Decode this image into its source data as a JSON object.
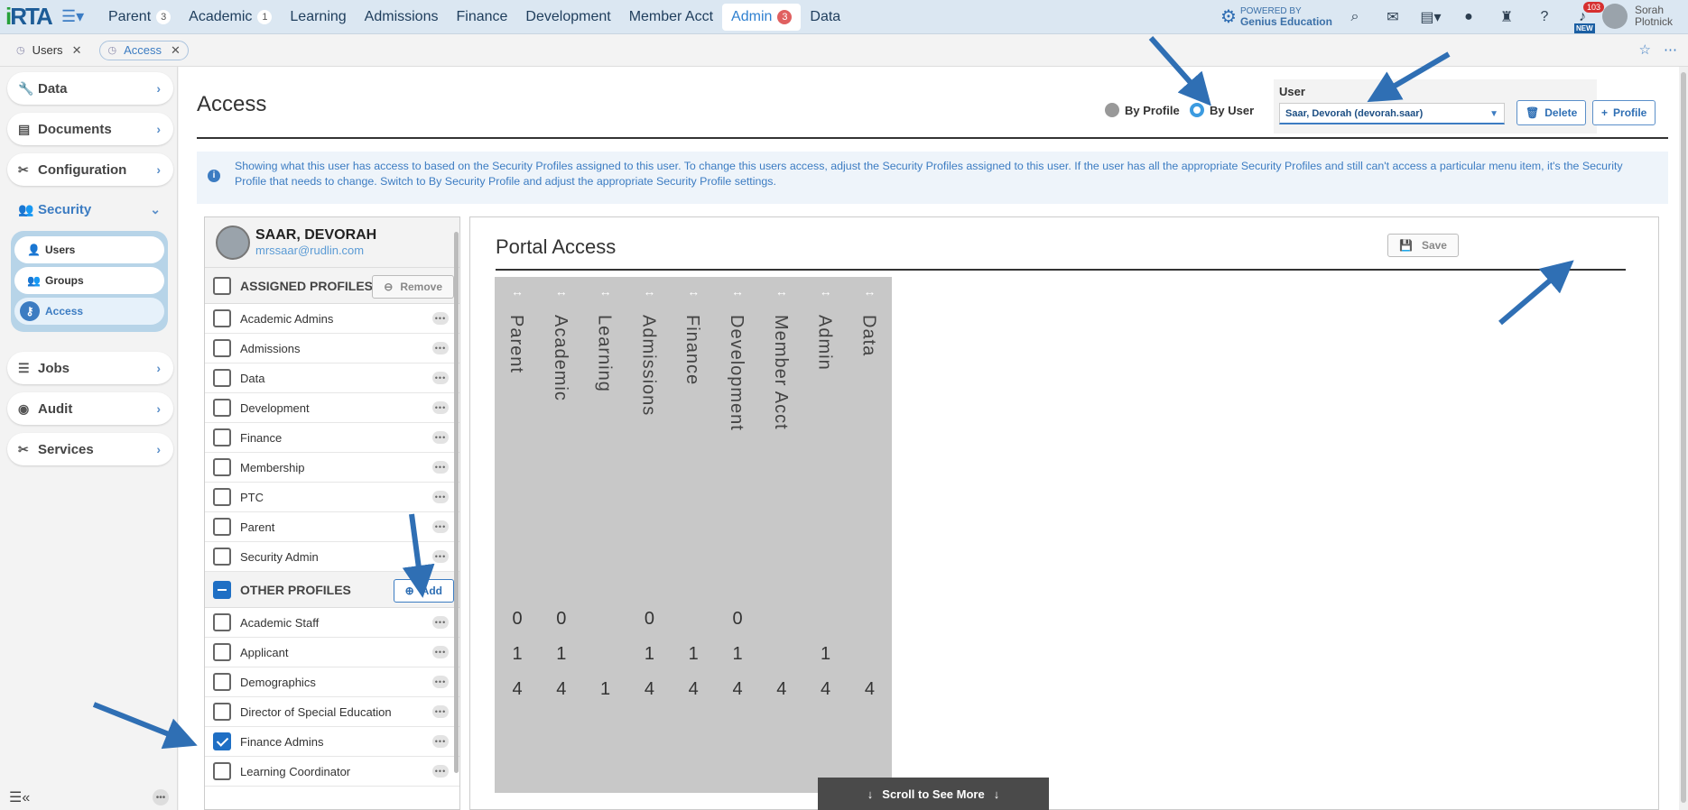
{
  "app": {
    "logo": "RTA",
    "logo_i": "i"
  },
  "nav": {
    "tabs": [
      {
        "label": "Parent",
        "badge": "3"
      },
      {
        "label": "Academic",
        "badge": "1"
      },
      {
        "label": "Learning"
      },
      {
        "label": "Admissions"
      },
      {
        "label": "Finance"
      },
      {
        "label": "Development"
      },
      {
        "label": "Member Acct"
      },
      {
        "label": "Admin",
        "badge": "3",
        "active": true
      },
      {
        "label": "Data"
      }
    ],
    "powered_by": "POWERED BY",
    "powered_brand": "Genius Education",
    "notifications_count": "103",
    "new_badge": "NEW",
    "user_first": "Sorah",
    "user_last": "Plotnick"
  },
  "tabbar": {
    "tabs": [
      {
        "label": "Users"
      },
      {
        "label": "Access",
        "active": true
      }
    ]
  },
  "sidebar": {
    "items": [
      {
        "label": "Data",
        "icon": "wrench-icon"
      },
      {
        "label": "Documents",
        "icon": "document-icon"
      },
      {
        "label": "Configuration",
        "icon": "tools-icon"
      },
      {
        "label": "Security",
        "icon": "users-lock-icon",
        "open": true
      },
      {
        "label": "Jobs",
        "icon": "list-icon"
      },
      {
        "label": "Audit",
        "icon": "eye-icon"
      },
      {
        "label": "Services",
        "icon": "tools-icon"
      }
    ],
    "sub": [
      {
        "label": "Users"
      },
      {
        "label": "Groups"
      },
      {
        "label": "Access",
        "active": true
      }
    ]
  },
  "page": {
    "title": "Access",
    "by_profile": "By Profile",
    "by_user": "By User",
    "user_label": "User",
    "user_value": "Saar, Devorah (devorah.saar)",
    "delete_label": "Delete",
    "profile_label": "Profile",
    "info": "Showing what this user has access to based on the Security Profiles assigned to this user. To change this users access, adjust the Security Profiles assigned to this user. If the user has all the appropriate Security Profiles and still can't access a particular menu item, it's the Security Profile that needs to change. Switch to By Security Profile and adjust the appropriate Security Profile settings."
  },
  "profile_panel": {
    "name": "SAAR, DEVORAH",
    "email": "mrssaar@rudlin.com",
    "assigned_title": "ASSIGNED PROFILES",
    "remove_label": "Remove",
    "assigned": [
      "Academic Admins",
      "Admissions",
      "Data",
      "Development",
      "Finance",
      "Membership",
      "PTC",
      "Parent",
      "Security Admin"
    ],
    "other_title": "OTHER PROFILES",
    "add_label": "Add",
    "other": [
      {
        "label": "Academic Staff",
        "checked": false
      },
      {
        "label": "Applicant",
        "checked": false
      },
      {
        "label": "Demographics",
        "checked": false
      },
      {
        "label": "Director of Special Education",
        "checked": false
      },
      {
        "label": "Finance Admins",
        "checked": true
      },
      {
        "label": "Learning Coordinator",
        "checked": false
      }
    ]
  },
  "portal": {
    "title": "Portal Access",
    "save_label": "Save",
    "arrow_glyph": "↔",
    "columns": [
      {
        "label": "Parent",
        "n0": "0",
        "n1": "1",
        "n4": "4"
      },
      {
        "label": "Academic",
        "n0": "0",
        "n1": "1",
        "n4": "4"
      },
      {
        "label": "Learning",
        "n0": "",
        "n1": "",
        "n4": "1"
      },
      {
        "label": "Admissions",
        "n0": "0",
        "n1": "1",
        "n4": "4"
      },
      {
        "label": "Finance",
        "n0": "",
        "n1": "1",
        "n4": "4"
      },
      {
        "label": "Development",
        "n0": "0",
        "n1": "1",
        "n4": "4"
      },
      {
        "label": "Member Acct",
        "n0": "",
        "n1": "",
        "n4": "4"
      },
      {
        "label": "Admin",
        "n0": "",
        "n1": "1",
        "n4": "4"
      },
      {
        "label": "Data",
        "n0": "",
        "n1": "",
        "n4": "4"
      }
    ],
    "scroll_more": "Scroll to See More"
  },
  "colors": {
    "accent": "#3c7cc2",
    "arrow": "#2f6fb4"
  }
}
